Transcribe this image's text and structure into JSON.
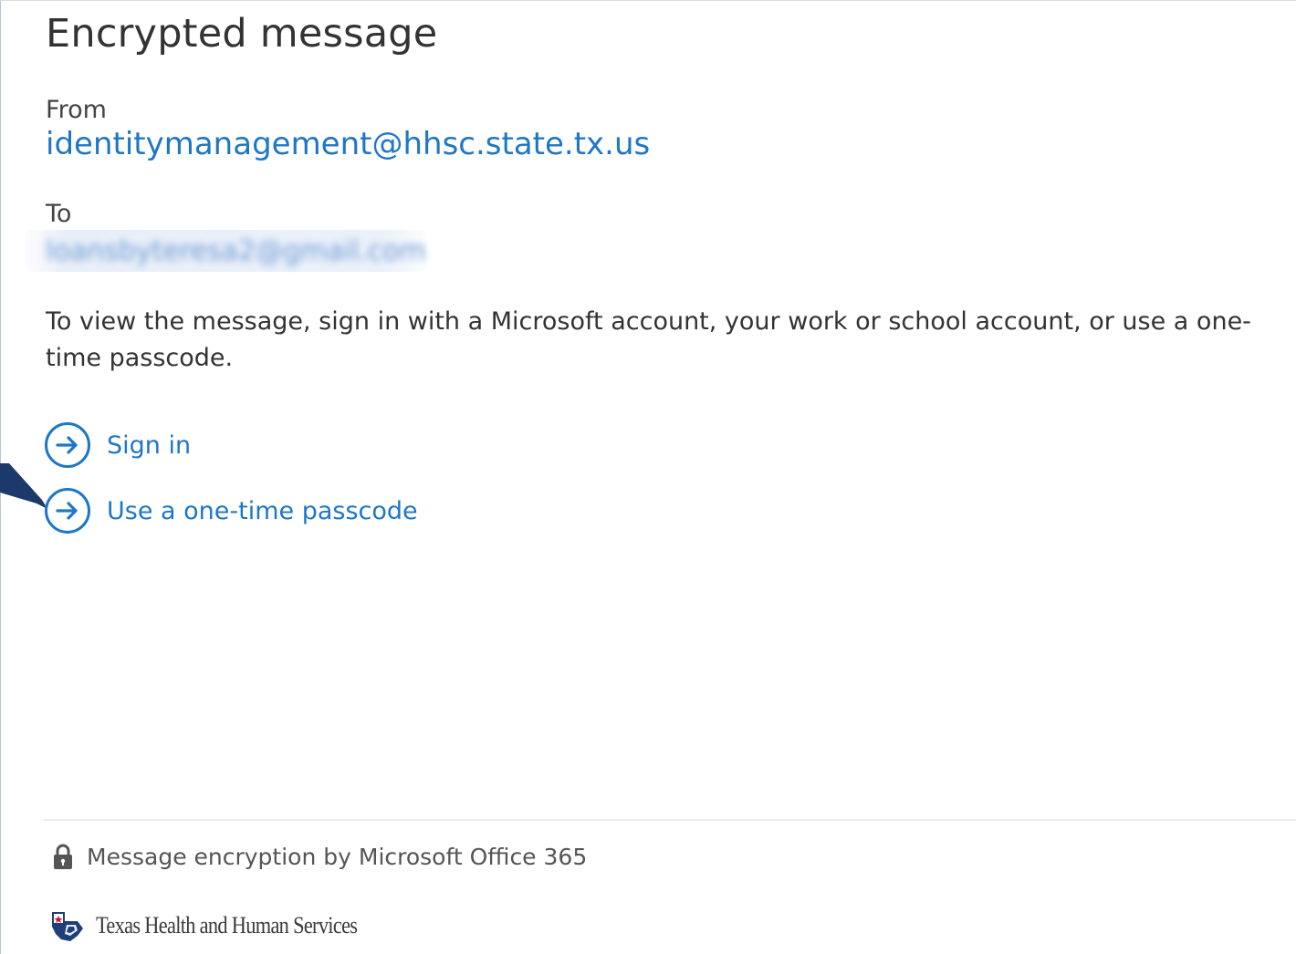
{
  "page": {
    "title": "Encrypted message"
  },
  "message": {
    "from_label": "From",
    "from_address": "identitymanagement@hhsc.state.tx.us",
    "to_label": "To",
    "to_address": "loansbyteresa2@gmail.com",
    "instructions": "To view the message, sign in with a Microsoft account, your work or school account, or use a one-time passcode."
  },
  "actions": [
    {
      "label": "Sign in",
      "icon": "arrow-circle-right-icon"
    },
    {
      "label": "Use a one-time passcode",
      "icon": "arrow-circle-right-icon"
    }
  ],
  "footer": {
    "encryption_note": "Message encryption by Microsoft Office 365",
    "lock_icon": "lock-icon",
    "organization": "Texas Health and Human Services"
  },
  "colors": {
    "link": "#1e77c6",
    "text": "#333333",
    "pointer_arrow": "#1b3a6b"
  }
}
